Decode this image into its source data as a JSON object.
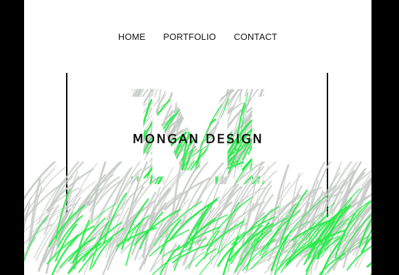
{
  "nav": {
    "items": [
      {
        "id": "home",
        "label": "HOME"
      },
      {
        "id": "portfolio",
        "label": "PORTFOLIO"
      },
      {
        "id": "contact",
        "label": "CONTACT"
      }
    ]
  },
  "hero": {
    "monogram_letter": "M",
    "brand_name": "MONGAN DESIGN"
  },
  "colors": {
    "grass_green": "#22ee44",
    "grass_gray": "#c4c9c4",
    "frame": "#000000",
    "background": "#ffffff"
  }
}
